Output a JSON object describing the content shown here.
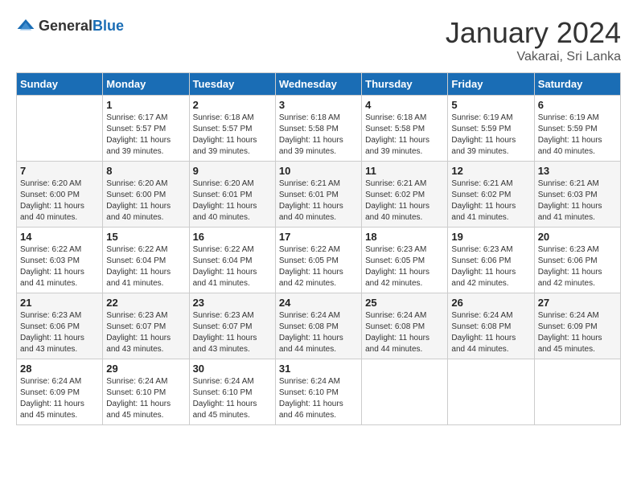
{
  "logo": {
    "general": "General",
    "blue": "Blue"
  },
  "title": "January 2024",
  "subtitle": "Vakarai, Sri Lanka",
  "headers": [
    "Sunday",
    "Monday",
    "Tuesday",
    "Wednesday",
    "Thursday",
    "Friday",
    "Saturday"
  ],
  "weeks": [
    [
      {
        "day": "",
        "sunrise": "",
        "sunset": "",
        "daylight": ""
      },
      {
        "day": "1",
        "sunrise": "Sunrise: 6:17 AM",
        "sunset": "Sunset: 5:57 PM",
        "daylight": "Daylight: 11 hours and 39 minutes."
      },
      {
        "day": "2",
        "sunrise": "Sunrise: 6:18 AM",
        "sunset": "Sunset: 5:57 PM",
        "daylight": "Daylight: 11 hours and 39 minutes."
      },
      {
        "day": "3",
        "sunrise": "Sunrise: 6:18 AM",
        "sunset": "Sunset: 5:58 PM",
        "daylight": "Daylight: 11 hours and 39 minutes."
      },
      {
        "day": "4",
        "sunrise": "Sunrise: 6:18 AM",
        "sunset": "Sunset: 5:58 PM",
        "daylight": "Daylight: 11 hours and 39 minutes."
      },
      {
        "day": "5",
        "sunrise": "Sunrise: 6:19 AM",
        "sunset": "Sunset: 5:59 PM",
        "daylight": "Daylight: 11 hours and 39 minutes."
      },
      {
        "day": "6",
        "sunrise": "Sunrise: 6:19 AM",
        "sunset": "Sunset: 5:59 PM",
        "daylight": "Daylight: 11 hours and 40 minutes."
      }
    ],
    [
      {
        "day": "7",
        "sunrise": "Sunrise: 6:20 AM",
        "sunset": "Sunset: 6:00 PM",
        "daylight": "Daylight: 11 hours and 40 minutes."
      },
      {
        "day": "8",
        "sunrise": "Sunrise: 6:20 AM",
        "sunset": "Sunset: 6:00 PM",
        "daylight": "Daylight: 11 hours and 40 minutes."
      },
      {
        "day": "9",
        "sunrise": "Sunrise: 6:20 AM",
        "sunset": "Sunset: 6:01 PM",
        "daylight": "Daylight: 11 hours and 40 minutes."
      },
      {
        "day": "10",
        "sunrise": "Sunrise: 6:21 AM",
        "sunset": "Sunset: 6:01 PM",
        "daylight": "Daylight: 11 hours and 40 minutes."
      },
      {
        "day": "11",
        "sunrise": "Sunrise: 6:21 AM",
        "sunset": "Sunset: 6:02 PM",
        "daylight": "Daylight: 11 hours and 40 minutes."
      },
      {
        "day": "12",
        "sunrise": "Sunrise: 6:21 AM",
        "sunset": "Sunset: 6:02 PM",
        "daylight": "Daylight: 11 hours and 41 minutes."
      },
      {
        "day": "13",
        "sunrise": "Sunrise: 6:21 AM",
        "sunset": "Sunset: 6:03 PM",
        "daylight": "Daylight: 11 hours and 41 minutes."
      }
    ],
    [
      {
        "day": "14",
        "sunrise": "Sunrise: 6:22 AM",
        "sunset": "Sunset: 6:03 PM",
        "daylight": "Daylight: 11 hours and 41 minutes."
      },
      {
        "day": "15",
        "sunrise": "Sunrise: 6:22 AM",
        "sunset": "Sunset: 6:04 PM",
        "daylight": "Daylight: 11 hours and 41 minutes."
      },
      {
        "day": "16",
        "sunrise": "Sunrise: 6:22 AM",
        "sunset": "Sunset: 6:04 PM",
        "daylight": "Daylight: 11 hours and 41 minutes."
      },
      {
        "day": "17",
        "sunrise": "Sunrise: 6:22 AM",
        "sunset": "Sunset: 6:05 PM",
        "daylight": "Daylight: 11 hours and 42 minutes."
      },
      {
        "day": "18",
        "sunrise": "Sunrise: 6:23 AM",
        "sunset": "Sunset: 6:05 PM",
        "daylight": "Daylight: 11 hours and 42 minutes."
      },
      {
        "day": "19",
        "sunrise": "Sunrise: 6:23 AM",
        "sunset": "Sunset: 6:06 PM",
        "daylight": "Daylight: 11 hours and 42 minutes."
      },
      {
        "day": "20",
        "sunrise": "Sunrise: 6:23 AM",
        "sunset": "Sunset: 6:06 PM",
        "daylight": "Daylight: 11 hours and 42 minutes."
      }
    ],
    [
      {
        "day": "21",
        "sunrise": "Sunrise: 6:23 AM",
        "sunset": "Sunset: 6:06 PM",
        "daylight": "Daylight: 11 hours and 43 minutes."
      },
      {
        "day": "22",
        "sunrise": "Sunrise: 6:23 AM",
        "sunset": "Sunset: 6:07 PM",
        "daylight": "Daylight: 11 hours and 43 minutes."
      },
      {
        "day": "23",
        "sunrise": "Sunrise: 6:23 AM",
        "sunset": "Sunset: 6:07 PM",
        "daylight": "Daylight: 11 hours and 43 minutes."
      },
      {
        "day": "24",
        "sunrise": "Sunrise: 6:24 AM",
        "sunset": "Sunset: 6:08 PM",
        "daylight": "Daylight: 11 hours and 44 minutes."
      },
      {
        "day": "25",
        "sunrise": "Sunrise: 6:24 AM",
        "sunset": "Sunset: 6:08 PM",
        "daylight": "Daylight: 11 hours and 44 minutes."
      },
      {
        "day": "26",
        "sunrise": "Sunrise: 6:24 AM",
        "sunset": "Sunset: 6:08 PM",
        "daylight": "Daylight: 11 hours and 44 minutes."
      },
      {
        "day": "27",
        "sunrise": "Sunrise: 6:24 AM",
        "sunset": "Sunset: 6:09 PM",
        "daylight": "Daylight: 11 hours and 45 minutes."
      }
    ],
    [
      {
        "day": "28",
        "sunrise": "Sunrise: 6:24 AM",
        "sunset": "Sunset: 6:09 PM",
        "daylight": "Daylight: 11 hours and 45 minutes."
      },
      {
        "day": "29",
        "sunrise": "Sunrise: 6:24 AM",
        "sunset": "Sunset: 6:10 PM",
        "daylight": "Daylight: 11 hours and 45 minutes."
      },
      {
        "day": "30",
        "sunrise": "Sunrise: 6:24 AM",
        "sunset": "Sunset: 6:10 PM",
        "daylight": "Daylight: 11 hours and 45 minutes."
      },
      {
        "day": "31",
        "sunrise": "Sunrise: 6:24 AM",
        "sunset": "Sunset: 6:10 PM",
        "daylight": "Daylight: 11 hours and 46 minutes."
      },
      {
        "day": "",
        "sunrise": "",
        "sunset": "",
        "daylight": ""
      },
      {
        "day": "",
        "sunrise": "",
        "sunset": "",
        "daylight": ""
      },
      {
        "day": "",
        "sunrise": "",
        "sunset": "",
        "daylight": ""
      }
    ]
  ]
}
